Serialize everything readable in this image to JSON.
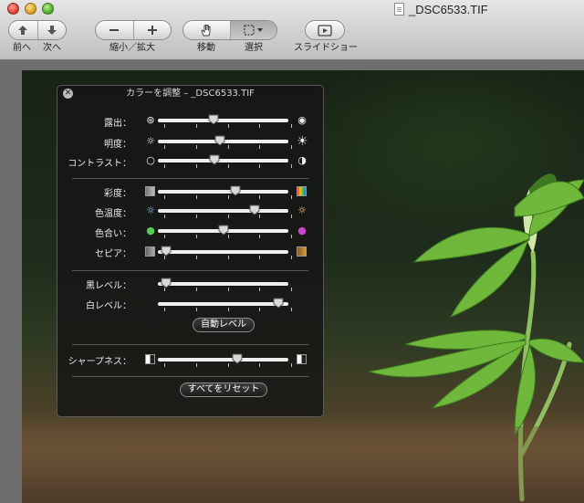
{
  "window": {
    "title": "_DSC6533.TIF"
  },
  "toolbar": {
    "prev_label": "前へ",
    "next_label": "次へ",
    "zoom_label": "縮小／拡大",
    "move_label": "移動",
    "select_label": "選択",
    "slideshow_label": "スライドショー"
  },
  "adjust": {
    "title": "カラーを調整 – _DSC6533.TIF",
    "exposure": {
      "label": "露出：",
      "value": 0.42
    },
    "brightness": {
      "label": "明度：",
      "value": 0.47
    },
    "contrast": {
      "label": "コントラスト：",
      "value": 0.43
    },
    "saturation": {
      "label": "彩度：",
      "value": 0.6
    },
    "temperature": {
      "label": "色温度：",
      "value": 0.76
    },
    "tint": {
      "label": "色合い：",
      "value": 0.5
    },
    "sepia": {
      "label": "セピア：",
      "value": 0.02
    },
    "black_level": {
      "label": "黒レベル：",
      "value": 0.02
    },
    "white_level": {
      "label": "白レベル：",
      "value": 0.96
    },
    "auto_levels_label": "自動レベル",
    "sharpness": {
      "label": "シャープネス：",
      "value": 0.62
    },
    "reset_all_label": "すべてをリセット"
  }
}
